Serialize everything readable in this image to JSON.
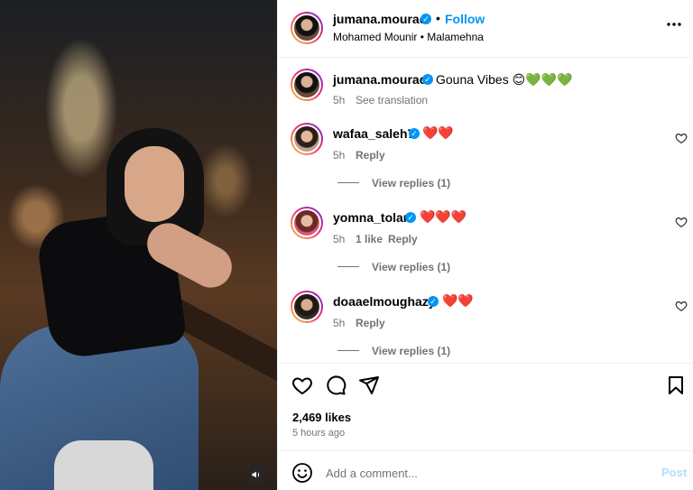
{
  "post": {
    "username": "jumana.mourad",
    "follow_label": "Follow",
    "dot": "•",
    "location": "Mohamed Mounir • Malamehna",
    "caption": "Gouna Vibes 😊💚💚💚",
    "caption_time": "5h",
    "see_translation": "See translation",
    "likes": "2,469 likes",
    "time_ago": "5 hours ago"
  },
  "comments": [
    {
      "username": "wafaa_saleh7",
      "text": "❤️❤️",
      "time": "5h",
      "likes": "",
      "reply": "Reply",
      "view_replies": "View replies (1)"
    },
    {
      "username": "yomna_tolan",
      "text": "❤️❤️❤️",
      "time": "5h",
      "likes": "1 like",
      "reply": "Reply",
      "view_replies": "View replies (1)"
    },
    {
      "username": "doaaelmoughazy",
      "text": "❤️❤️",
      "time": "5h",
      "likes": "",
      "reply": "Reply",
      "view_replies": "View replies (1)"
    }
  ],
  "composer": {
    "placeholder": "Add a comment...",
    "post_label": "Post"
  },
  "icons": {
    "more": "more-horizontal-icon",
    "like": "heart-icon",
    "comment": "comment-icon",
    "share": "share-icon",
    "save": "bookmark-icon",
    "emoji": "emoji-icon",
    "sound": "speaker-icon",
    "verified": "verified-badge-icon"
  },
  "colors": {
    "accent": "#0095f6",
    "post_disabled": "#b2dffc",
    "muted_text": "#737373"
  }
}
